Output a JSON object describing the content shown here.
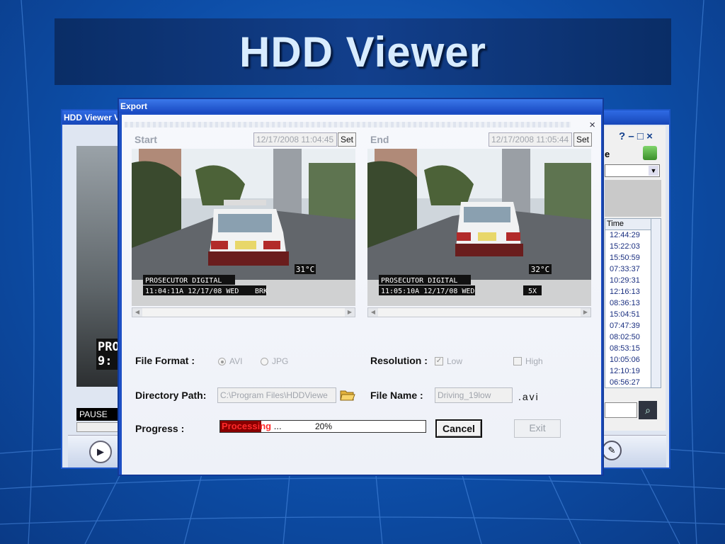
{
  "slide_title": "HDD Viewer",
  "back_window": {
    "title": "HDD Viewer V",
    "overlay_text_line1": "PRO",
    "overlay_text_line2": "9:",
    "pause_label": "PAUSE",
    "title_controls": "? – □ ×",
    "partial_label": "e",
    "time_header": "Time",
    "times": [
      "12:44:29",
      "15:22:03",
      "15:50:59",
      "07:33:37",
      "10:29:31",
      "12:16:13",
      "08:36:13",
      "15:04:51",
      "07:47:39",
      "08:02:50",
      "08:53:15",
      "10:05:06",
      "12:10:19",
      "06:56:27"
    ]
  },
  "export_dialog": {
    "title": "Export",
    "close_label": "×",
    "start": {
      "label": "Start",
      "timestamp": "12/17/2008  11:04:45",
      "set_label": "Set",
      "overlay_line1": "PROSECUTOR DIGITAL",
      "overlay_line2": "11:04:11A 12/17/08 WED",
      "overlay_tag": "BRK",
      "temperature": "31°C"
    },
    "end": {
      "label": "End",
      "timestamp": "12/17/2008  11:05:44",
      "set_label": "Set",
      "overlay_line1": "PROSECUTOR DIGITAL",
      "overlay_line2": "11:05:10A 12/17/08 WED",
      "overlay_tag": "5X",
      "temperature": "32°C"
    },
    "file_format": {
      "label": "File Format :",
      "options": [
        "AVI",
        "JPG"
      ],
      "selected": "AVI"
    },
    "resolution": {
      "label": "Resolution :",
      "low_label": "Low",
      "high_label": "High",
      "low_checked": true,
      "high_checked": false
    },
    "directory_path": {
      "label": "Directory Path:",
      "value": "C:\\Program Files\\HDDViewe"
    },
    "file_name": {
      "label": "File Name :",
      "value": "Driving_19low",
      "extension": ".avi"
    },
    "progress": {
      "label": "Progress :",
      "status_text": "Processing",
      "status_tail": "...",
      "percent_text": "20%",
      "percent": 0.2
    },
    "cancel_label": "Cancel",
    "exit_label": "Exit"
  }
}
